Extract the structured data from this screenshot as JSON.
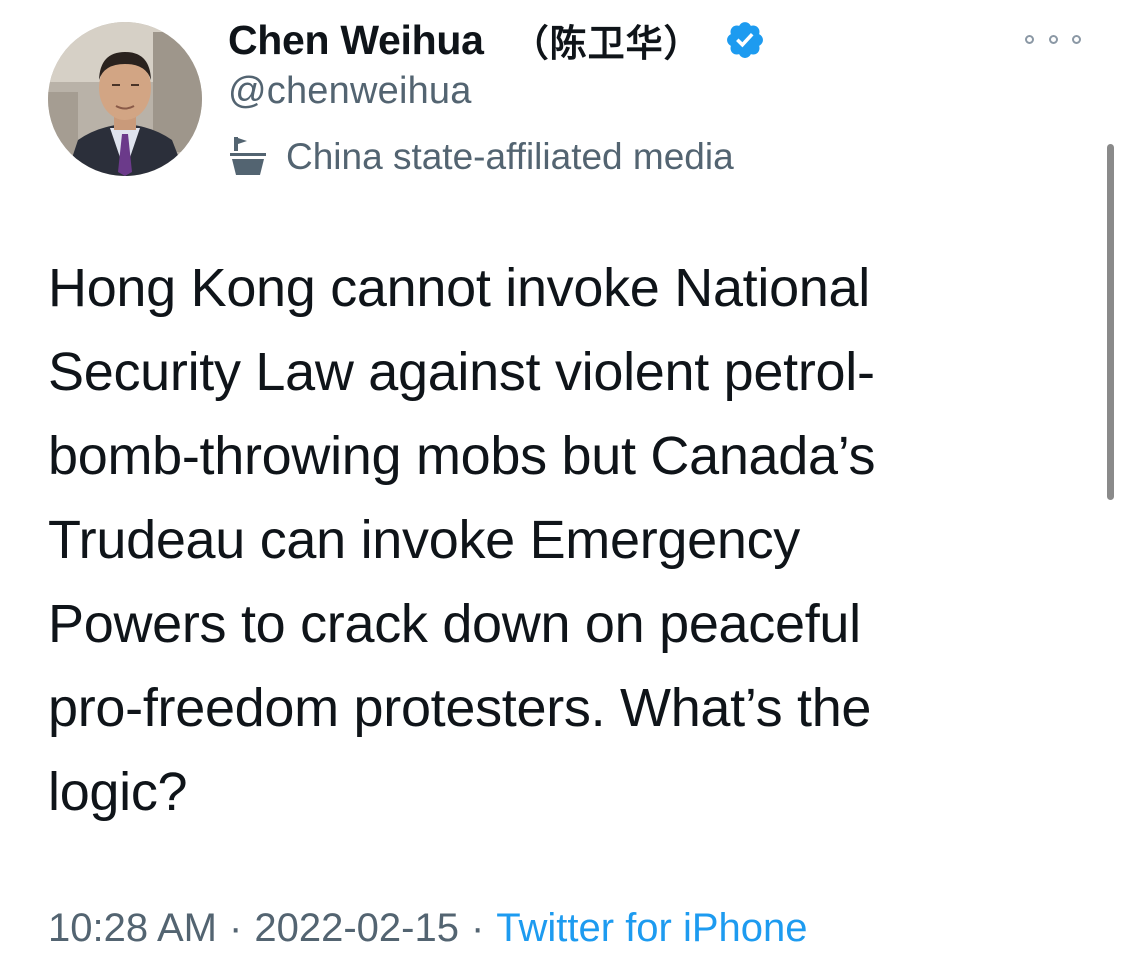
{
  "tweet": {
    "author": {
      "display_name": "Chen Weihua",
      "cjk_name": "（陈卫华）",
      "handle": "@chenweihua",
      "verified_icon": "verified-badge-icon",
      "label_icon": "government-flag-icon",
      "label": "China state-affiliated media"
    },
    "text": "Hong Kong cannot invoke National\nSecurity Law against violent petrol-\nbomb-throwing mobs but Canada’s\nTrudeau can invoke Emergency\nPowers to crack down on peaceful\npro-freedom protesters. What’s the\nlogic?",
    "time": "10:28 AM",
    "separator": "·",
    "date": "2022-02-15",
    "source": "Twitter for iPhone",
    "more_icon": "more-options-icon"
  },
  "colors": {
    "text_primary": "#0f1419",
    "text_secondary": "#536471",
    "link": "#1d9bf0",
    "verified": "#1d9bf0"
  }
}
